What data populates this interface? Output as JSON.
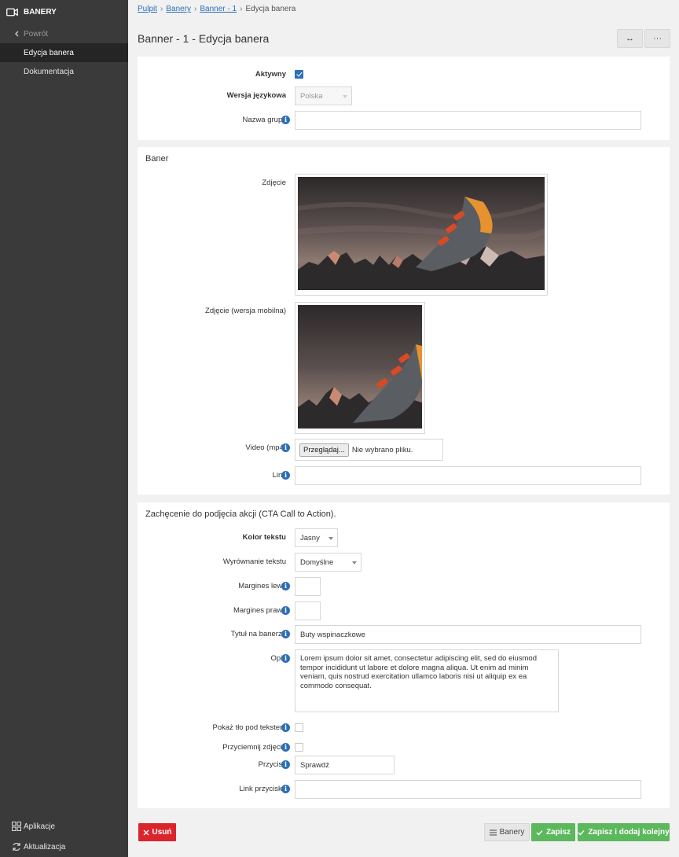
{
  "sidebar": {
    "app_title": "BANERY",
    "back_label": "Powrót",
    "items": [
      {
        "label": "Edycja banera"
      },
      {
        "label": "Dokumentacja"
      }
    ],
    "bottom": [
      {
        "label": "Aplikacje",
        "icon": "grid-icon"
      },
      {
        "label": "Aktualizacja",
        "icon": "refresh-icon"
      }
    ]
  },
  "breadcrumb": [
    "Pulpit",
    "Banery",
    "Banner - 1",
    "Edycja banera"
  ],
  "page": {
    "title": "Banner - 1 - Edycja banera",
    "expand_label": "↔",
    "more_label": "···"
  },
  "general": {
    "active_label": "Aktywny",
    "active_checked": true,
    "language_label": "Wersja językowa",
    "language_value": "Polska",
    "group_label": "Nazwa grupy",
    "group_value": ""
  },
  "banner": {
    "section_title": "Baner",
    "photo_label": "Zdjęcie",
    "photo_mobile_label": "Zdjęcie (wersja mobilna)",
    "video_label": "Video (mp4)",
    "video_button": "Przeglądaj...",
    "video_status": "Nie wybrano pliku.",
    "link_label": "Link",
    "link_value": ""
  },
  "cta": {
    "section_title": "Zachęcenie do podjęcia akcji (CTA Call to Action).",
    "text_color_label": "Kolor tekstu",
    "text_color_value": "Jasny",
    "align_label": "Wyrównanie tekstu",
    "align_value": "Domyślne",
    "margin_left_label": "Margines lewy",
    "margin_left_value": "",
    "margin_right_label": "Margines prawy",
    "margin_right_value": "",
    "title_label": "Tytuł na banerze",
    "title_value": "Buty wspinaczkowe",
    "desc_label": "Opis",
    "desc_value": "Lorem ipsum dolor sit amet, consectetur adipiscing elit, sed do eiusmod tempor incididunt ut labore et dolore magna aliqua. Ut enim ad minim veniam, quis nostrud exercitation ullamco laboris nisi ut aliquip ex ea commodo consequat.",
    "bg_label": "Pokaż tło pod tekstem",
    "bg_checked": false,
    "dim_label": "Przyciemnij zdjęcie",
    "dim_checked": false,
    "button_label": "Przycisk",
    "button_value": "Sprawdź",
    "button_link_label": "Link przycisku",
    "button_link_value": ""
  },
  "actions": {
    "delete": "Usuń",
    "list": "Banery",
    "save": "Zapisz",
    "save_add": "Zapisz i dodaj kolejny"
  },
  "colors": {
    "sidebar_bg": "#3a3a3a",
    "accent": "#2c6fb7",
    "danger": "#d9252b",
    "success": "#5cb85c"
  }
}
